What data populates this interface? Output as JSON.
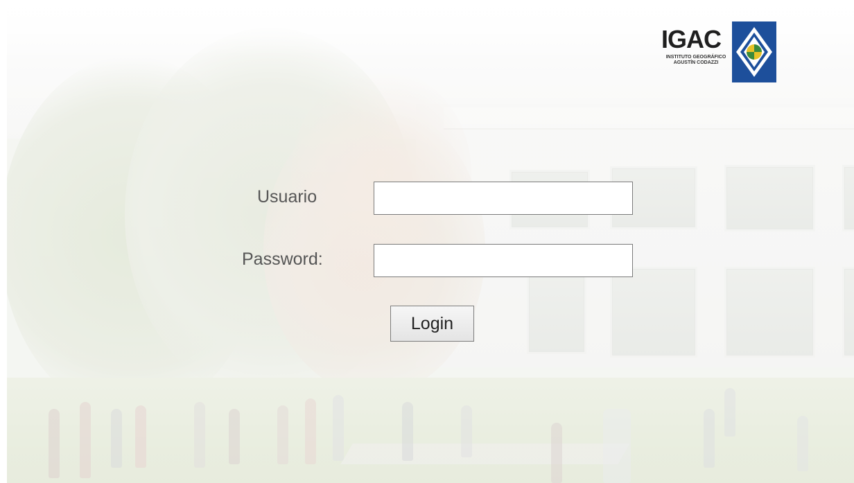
{
  "logo": {
    "name": "IGAC",
    "subtitle_line1": "INSTITUTO GEOGRÁFICO",
    "subtitle_line2": "AGUSTÍN CODAZZI",
    "brand_color": "#1d4f9b"
  },
  "form": {
    "username_label": "Usuario",
    "username_value": "",
    "password_label": "Password:",
    "password_value": "",
    "login_label": "Login"
  },
  "background": {
    "description_icon": "campus-photo"
  }
}
